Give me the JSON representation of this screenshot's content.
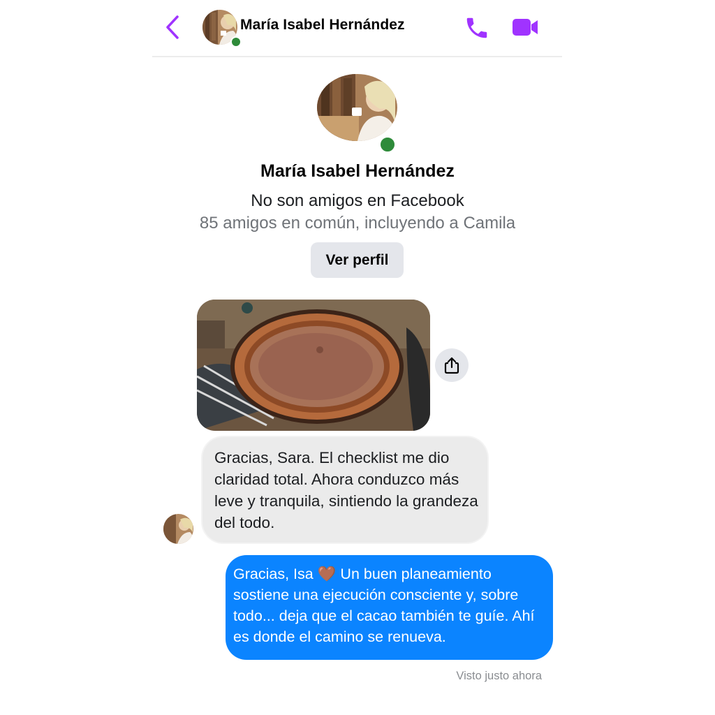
{
  "header": {
    "contact_name": "María Isabel Hernández"
  },
  "profile": {
    "name": "María Isabel Hernández",
    "relationship": "No son amigos en Facebook",
    "mutual": "85 amigos en común, incluyendo a Camila",
    "view_profile_label": "Ver perfil"
  },
  "messages": {
    "incoming_text": "Gracias, Sara. El checklist me dio claridad total. Ahora conduzco más leve y tranquila, sintiendo la grandeza del todo.",
    "outgoing_text": "Gracias, Isa 🤎 Un buen planeamiento sostiene una ejecución consciente y, sobre todo... deja que el cacao también te guíe. Ahí es donde el camino se renueva.",
    "seen_status": "Visto justo ahora"
  },
  "icons": {
    "back": "chevron-left-icon",
    "call": "phone-icon",
    "video": "video-camera-icon",
    "share": "share-icon"
  },
  "colors": {
    "accent": "#a033ff",
    "outgoing_bubble": "#0b84ff",
    "incoming_bubble": "#ebebeb",
    "online": "#2e8b3a"
  }
}
